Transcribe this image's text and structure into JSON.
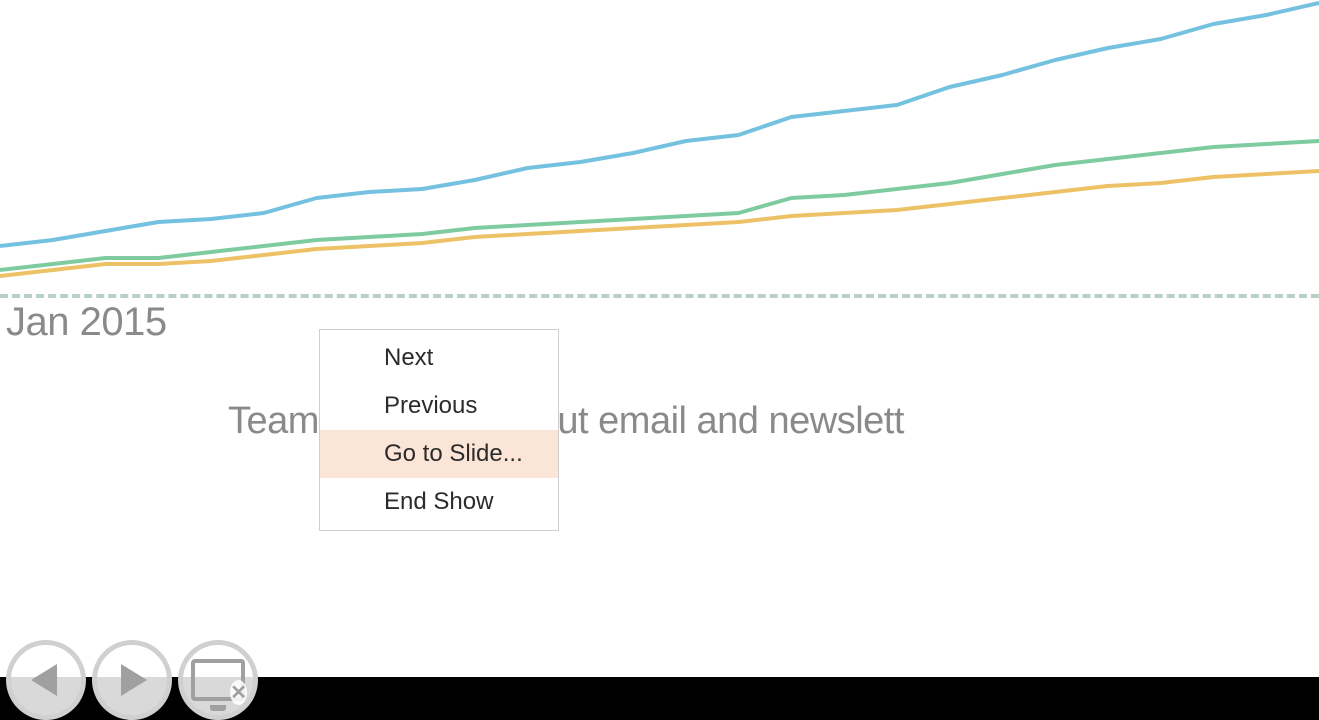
{
  "chart_data": {
    "type": "line",
    "x_axis_label_shown": "Jan 2015",
    "series": [
      {
        "name": "blue",
        "color": "#75c1e0",
        "values": [
          18,
          20,
          23,
          26,
          27,
          29,
          34,
          36,
          37,
          40,
          44,
          46,
          49,
          53,
          55,
          61,
          63,
          65,
          71,
          75,
          80,
          84,
          87,
          92,
          95,
          99
        ]
      },
      {
        "name": "green",
        "color": "#7fcba0",
        "values": [
          10,
          12,
          14,
          14,
          16,
          18,
          20,
          21,
          22,
          24,
          25,
          26,
          27,
          28,
          29,
          34,
          35,
          37,
          39,
          42,
          45,
          47,
          49,
          51,
          52,
          53
        ]
      },
      {
        "name": "yellow",
        "color": "#edc165",
        "values": [
          8,
          10,
          12,
          12,
          13,
          15,
          17,
          18,
          19,
          21,
          22,
          23,
          24,
          25,
          26,
          28,
          29,
          30,
          32,
          34,
          36,
          38,
          39,
          41,
          42,
          43
        ]
      }
    ],
    "y_range": [
      0,
      100
    ],
    "x_range_points": 26,
    "caption_visible_fragment": "Team                grown fast—but email and newslett"
  },
  "context_menu": {
    "items": [
      {
        "label": "Next",
        "highlight": false
      },
      {
        "label": "Previous",
        "highlight": false
      },
      {
        "label": "Go to Slide...",
        "highlight": true
      },
      {
        "label": "End Show",
        "highlight": false
      }
    ]
  },
  "transport": {
    "prev_tooltip": "Previous Slide",
    "next_tooltip": "Next Slide",
    "end_tooltip": "End Show"
  }
}
